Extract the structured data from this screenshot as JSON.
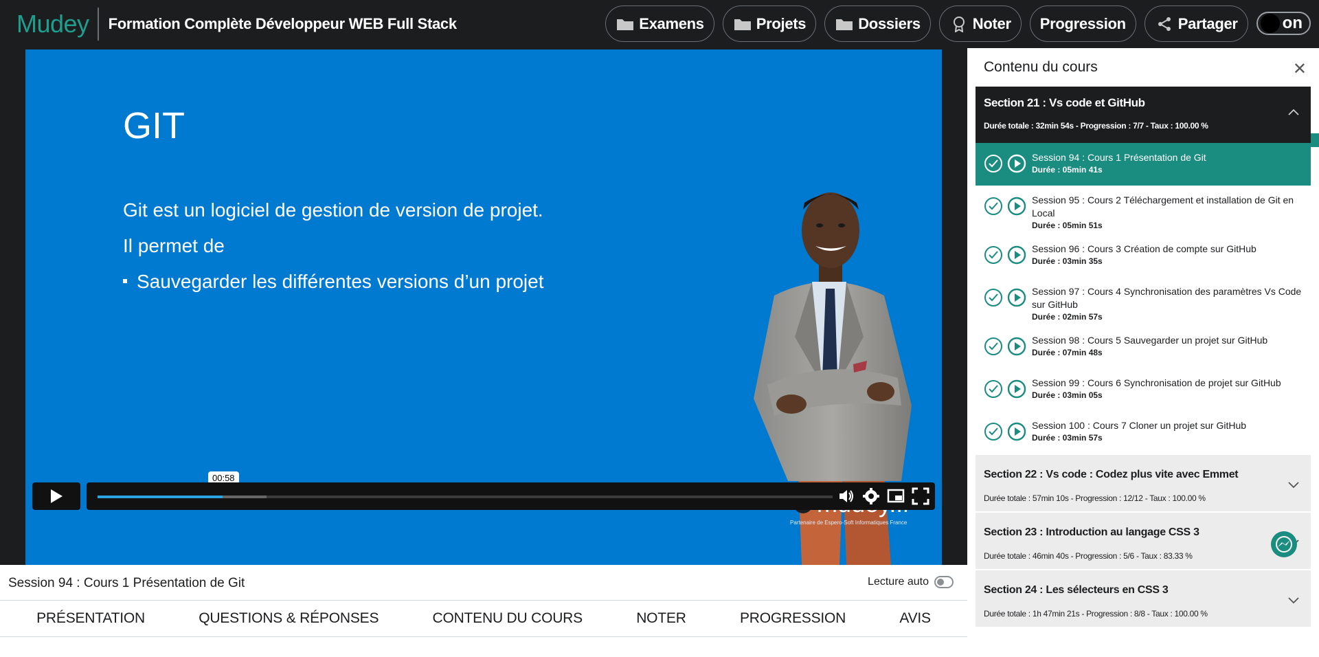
{
  "header": {
    "logo": "Mudey",
    "course_title": "Formation Complète Développeur WEB Full Stack",
    "nav": [
      {
        "label": "Examens",
        "icon": "folder-icon"
      },
      {
        "label": "Projets",
        "icon": "folder-icon"
      },
      {
        "label": "Dossiers",
        "icon": "folder-icon"
      },
      {
        "label": "Noter",
        "icon": "award-icon"
      },
      {
        "label": "Progression",
        "icon": ""
      },
      {
        "label": "Partager",
        "icon": "share-icon"
      }
    ],
    "toggle_label": "on"
  },
  "slide": {
    "title": "GIT",
    "line1": "Git est un logiciel de gestion de version de projet.",
    "line2": "Il permet de",
    "bullet1": "Sauvegarder les différentes versions d’un projet",
    "watermark": "mudey.fr",
    "watermark_badge": "M",
    "watermark_sub": "Partenaire de Espero-Soft Informatiques France"
  },
  "player": {
    "current_time": "00:58",
    "progress_played": 0.17,
    "progress_buffered": 0.23
  },
  "session_title": "Session 94 : Cours 1 Présentation de Git",
  "autoplay_label": "Lecture auto",
  "tabs": [
    "PRÉSENTATION",
    "QUESTIONS & RÉPONSES",
    "CONTENU DU COURS",
    "NOTER",
    "PROGRESSION",
    "AVIS"
  ],
  "sidebar": {
    "title": "Contenu du cours",
    "open_section": {
      "title": "Section 21 : Vs code et GitHub",
      "meta": "Durée totale : 32min 54s  - Progression : 7/7  - Taux : 100.00 %"
    },
    "lessons": [
      {
        "title": "Session 94 : Cours 1 Présentation de Git",
        "duration": "Durée : 05min 41s",
        "active": true
      },
      {
        "title": "Session 95 : Cours 2 Téléchargement et installation de Git en Local",
        "duration": "Durée : 05min 51s",
        "active": false
      },
      {
        "title": "Session 96 : Cours 3 Création de compte sur GitHub",
        "duration": "Durée : 03min 35s",
        "active": false
      },
      {
        "title": "Session 97 : Cours 4 Synchronisation des paramètres Vs Code sur GitHub",
        "duration": "Durée : 02min 57s",
        "active": false
      },
      {
        "title": "Session 98 : Cours 5 Sauvegarder un projet sur GitHub",
        "duration": "Durée : 07min 48s",
        "active": false
      },
      {
        "title": "Session 99 : Cours 6 Synchronisation de projet sur GitHub",
        "duration": "Durée : 03min 05s",
        "active": false
      },
      {
        "title": "Session 100 : Cours 7 Cloner un projet sur GitHub",
        "duration": "Durée : 03min 57s",
        "active": false
      }
    ],
    "closed_sections": [
      {
        "title": "Section 22 : Vs code : Codez plus vite avec Emmet",
        "meta": "Durée totale : 57min 10s  - Progression : 12/12  - Taux : 100.00 %"
      },
      {
        "title": "Section 23 : Introduction au langage CSS 3",
        "meta": "Durée totale : 46min 40s  - Progression : 5/6  - Taux : 83.33 %"
      },
      {
        "title": "Section 24 : Les sélecteurs en CSS 3",
        "meta": "Durée totale : 1h 47min 21s  - Progression : 8/8  - Taux : 100.00 %"
      }
    ]
  },
  "colors": {
    "brand": "#1f9e8e",
    "active_lesson": "#1a8c80",
    "slide_bg": "#0079d1",
    "topbar_bg": "#1c1d1f",
    "progress": "#2aa3e0"
  }
}
